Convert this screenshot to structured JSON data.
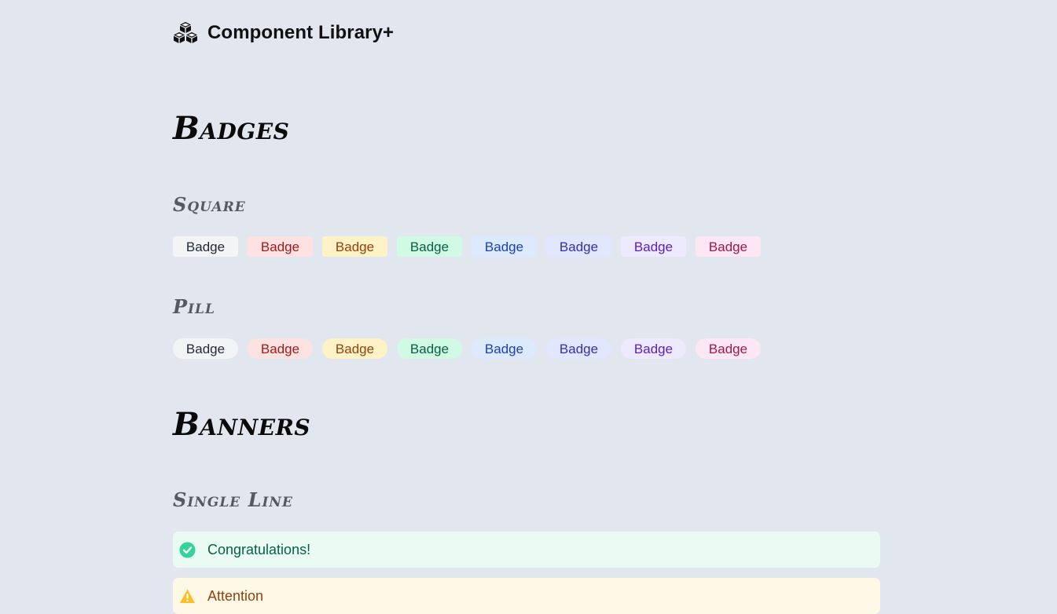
{
  "header": {
    "title": "Component Library+",
    "icon": "cubes-icon"
  },
  "badges_section": {
    "title": "Badges",
    "square": {
      "title": "Square",
      "items": [
        {
          "label": "Badge",
          "bg": "#f3f4f6",
          "fg": "#1f2937"
        },
        {
          "label": "Badge",
          "bg": "#fee2e2",
          "fg": "#991b1b"
        },
        {
          "label": "Badge",
          "bg": "#fef3c7",
          "fg": "#92400e"
        },
        {
          "label": "Badge",
          "bg": "#d1fae5",
          "fg": "#065f46"
        },
        {
          "label": "Badge",
          "bg": "#dbeafe",
          "fg": "#1e40af"
        },
        {
          "label": "Badge",
          "bg": "#e0e7ff",
          "fg": "#3730a3"
        },
        {
          "label": "Badge",
          "bg": "#ede9fe",
          "fg": "#5b21b6"
        },
        {
          "label": "Badge",
          "bg": "#fce7f3",
          "fg": "#9d174d"
        }
      ]
    },
    "pill": {
      "title": "Pill",
      "items": [
        {
          "label": "Badge",
          "bg": "#f3f4f6",
          "fg": "#1f2937"
        },
        {
          "label": "Badge",
          "bg": "#fee2e2",
          "fg": "#991b1b"
        },
        {
          "label": "Badge",
          "bg": "#fef3c7",
          "fg": "#92400e"
        },
        {
          "label": "Badge",
          "bg": "#d1fae5",
          "fg": "#065f46"
        },
        {
          "label": "Badge",
          "bg": "#dbeafe",
          "fg": "#1e40af"
        },
        {
          "label": "Badge",
          "bg": "#e0e7ff",
          "fg": "#3730a3"
        },
        {
          "label": "Badge",
          "bg": "#ede9fe",
          "fg": "#5b21b6"
        },
        {
          "label": "Badge",
          "bg": "#fce7f3",
          "fg": "#9d174d"
        }
      ]
    }
  },
  "banners_section": {
    "title": "Banners",
    "single_line": {
      "title": "Single Line",
      "items": [
        {
          "text": "Congratulations!",
          "icon": "check-circle-icon",
          "bg": "#e9fbf3",
          "fg": "#065f46",
          "icon_color": "#34d399"
        },
        {
          "text": "Attention",
          "icon": "warning-triangle-icon",
          "bg": "#fdf9e6",
          "fg": "#92400e",
          "icon_color": "#fbbf24"
        }
      ]
    }
  }
}
